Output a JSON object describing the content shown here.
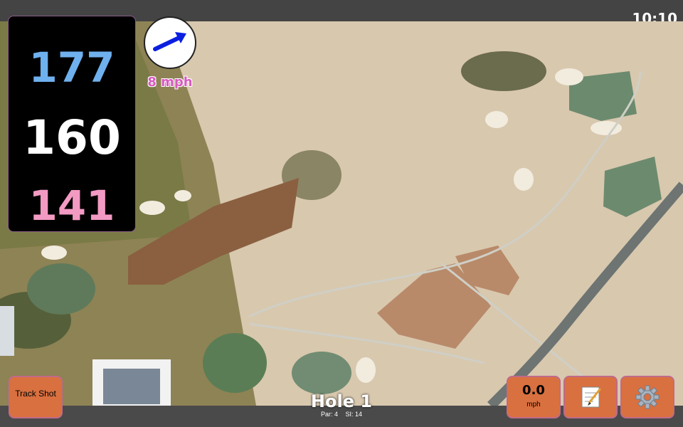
{
  "status": {
    "time": "10:10"
  },
  "distances": {
    "back": "177",
    "middle": "160",
    "front": "141"
  },
  "wind": {
    "speed_label": "8 mph",
    "icon": "arrow-right-icon"
  },
  "hole": {
    "title": "Hole 1",
    "par": "Par: 4",
    "si": "SI: 14"
  },
  "buttons": {
    "track_shot": "Track Shot",
    "speed_value": "0.0",
    "speed_unit": "mph",
    "notes_icon": "notepad-icon",
    "settings_icon": "gear-icon"
  },
  "colors": {
    "back": "#6fb0ee",
    "middle": "#ffffff",
    "front": "#f39ac3",
    "button": "#d9703f",
    "wind_text": "#d85ac0"
  }
}
